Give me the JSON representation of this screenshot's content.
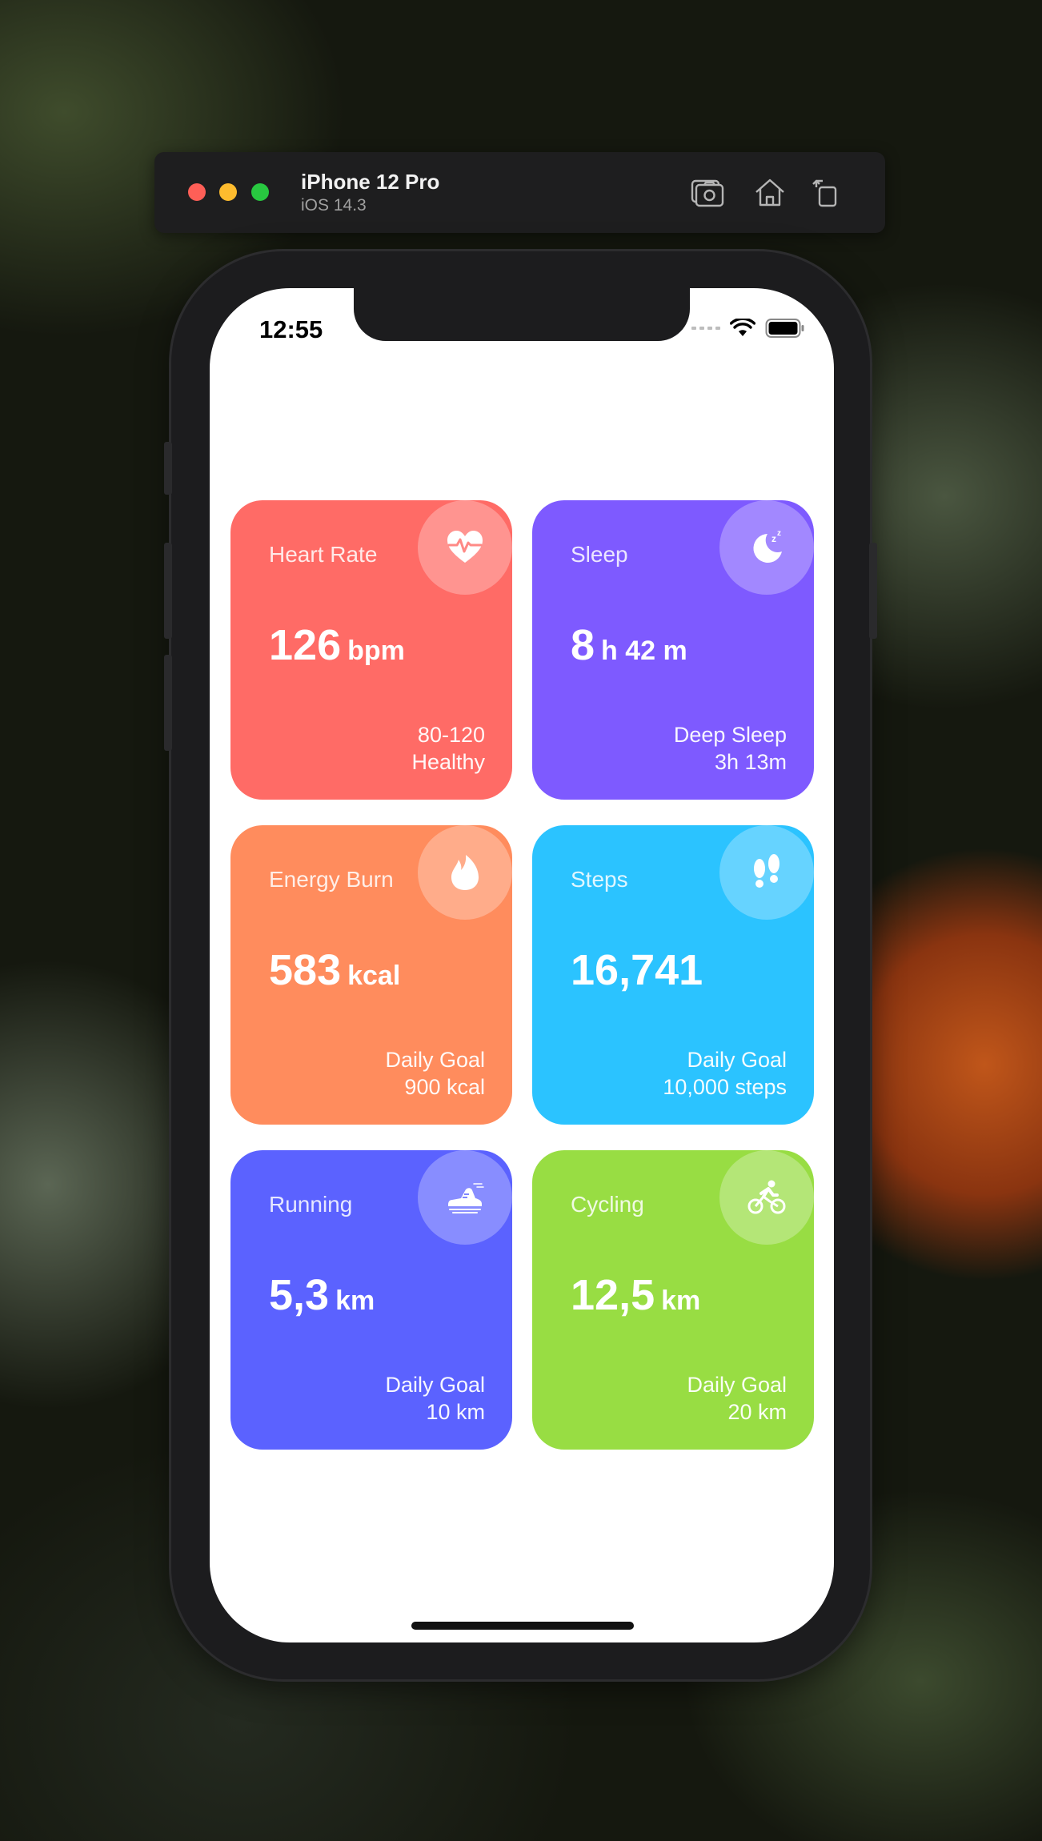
{
  "simulator": {
    "device_name": "iPhone 12 Pro",
    "os_version": "iOS 14.3",
    "toolbar_icons": [
      "screenshot-icon",
      "home-icon",
      "rotate-icon"
    ]
  },
  "status_bar": {
    "time": "12:55"
  },
  "cards": [
    {
      "label": "Heart Rate",
      "value": "126",
      "unit": "bpm",
      "sub1": "80-120",
      "sub2": "Healthy",
      "icon": "heart-rate-icon",
      "color": "#ff6b66"
    },
    {
      "label": "Sleep",
      "value": "8",
      "unit": "h 42 m",
      "sub1": "Deep Sleep",
      "sub2": "3h 13m",
      "icon": "moon-sleep-icon",
      "color": "#7e5aff"
    },
    {
      "label": "Energy Burn",
      "value": "583",
      "unit": "kcal",
      "sub1": "Daily Goal",
      "sub2": "900 kcal",
      "icon": "flame-icon",
      "color": "#ff8c5d"
    },
    {
      "label": "Steps",
      "value": "16,741",
      "unit": "",
      "sub1": "Daily Goal",
      "sub2": "10,000 steps",
      "icon": "footprints-icon",
      "color": "#2bc3ff"
    },
    {
      "label": "Running",
      "value": "5,3",
      "unit": "km",
      "sub1": "Daily Goal",
      "sub2": "10 km",
      "icon": "running-shoe-icon",
      "color": "#5b62ff"
    },
    {
      "label": "Cycling",
      "value": "12,5",
      "unit": "km",
      "sub1": "Daily Goal",
      "sub2": "20 km",
      "icon": "cyclist-icon",
      "color": "#98dd43"
    }
  ]
}
